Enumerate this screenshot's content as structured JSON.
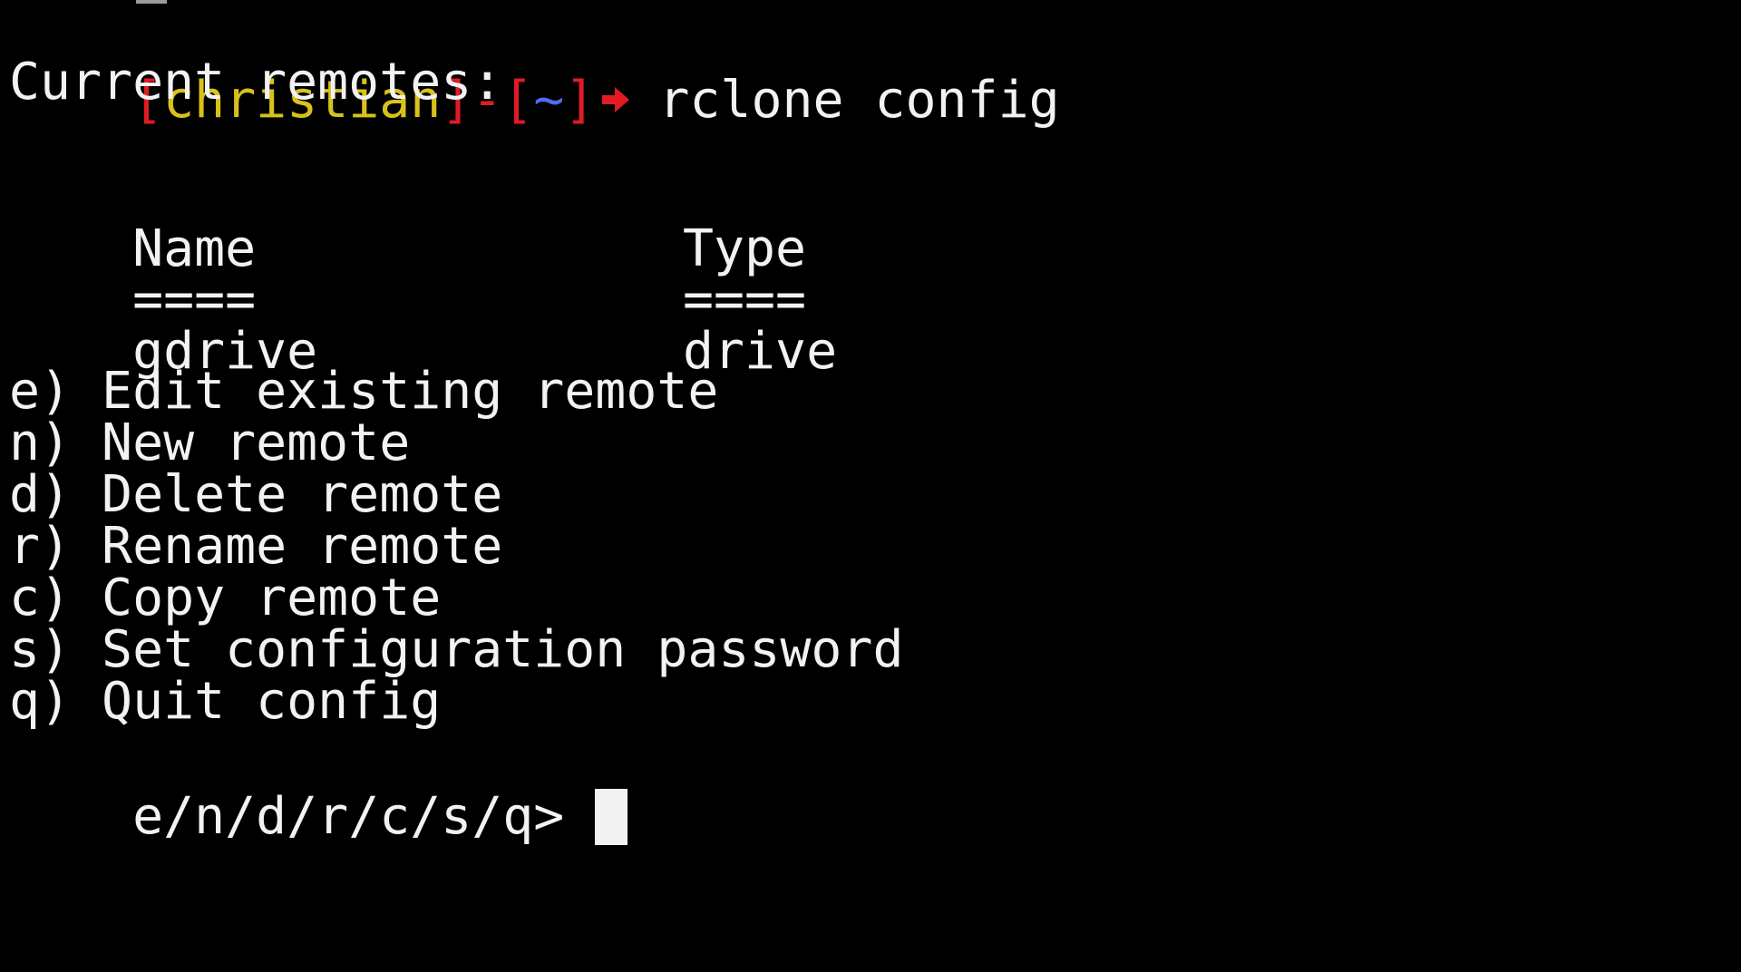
{
  "prompt": {
    "open_bracket": "[",
    "user": "christian",
    "close_bracket_dash": "]-[",
    "cwd": "~",
    "close_bracket": "]",
    "command": "rclone config"
  },
  "colors": {
    "bracket": "#e01b24",
    "user": "#d7c21a",
    "cwd": "#4e6cf0",
    "arrow": "#e01b24",
    "text": "#f2f2f2",
    "background": "#000000"
  },
  "output": {
    "header": "Current remotes:",
    "table": {
      "columns": [
        "Name",
        "Type"
      ],
      "underline": [
        "====",
        "===="
      ],
      "rows": [
        {
          "name": "gdrive",
          "type": "drive"
        }
      ]
    },
    "menu": [
      "e) Edit existing remote",
      "n) New remote",
      "d) Delete remote",
      "r) Rename remote",
      "c) Copy remote",
      "s) Set configuration password",
      "q) Quit config"
    ],
    "input_prompt": "e/n/d/r/c/s/q> "
  },
  "icons": {
    "prompt_arrow": "right-arrow-icon",
    "cursor": "block-cursor"
  }
}
